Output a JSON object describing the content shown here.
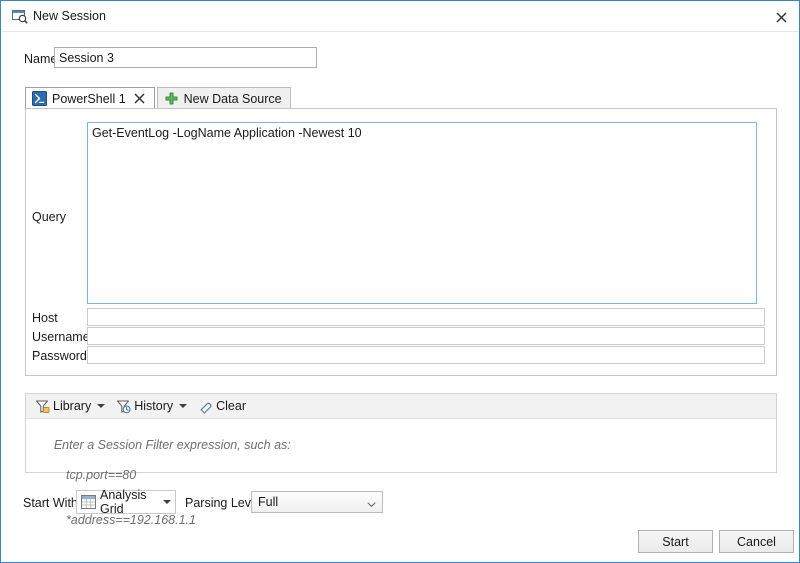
{
  "window": {
    "title": "New Session",
    "title_icon": "session-window-search-icon",
    "close_icon": "close-icon"
  },
  "name_row": {
    "label": "Name:",
    "value": "Session 3",
    "placeholder": ""
  },
  "tabs": [
    {
      "label": "PowerShell 1",
      "icon": "powershell-icon",
      "active": true,
      "close_icon": "tab-close-icon"
    },
    {
      "label": "New Data Source",
      "icon": "plus-icon",
      "active": false
    }
  ],
  "query_panel": {
    "query_label": "Query",
    "query_value": "Get-EventLog -LogName Application -Newest 10",
    "fields": [
      {
        "label": "Host",
        "value": "",
        "name": "host"
      },
      {
        "label": "Username",
        "value": "",
        "name": "username"
      },
      {
        "label": "Password",
        "value": "",
        "name": "password"
      }
    ]
  },
  "filter_panel": {
    "toolbar": [
      {
        "label": "Library",
        "icon": "filter-library-icon",
        "has_caret": true
      },
      {
        "label": "History",
        "icon": "filter-history-icon",
        "has_caret": true
      },
      {
        "label": "Clear",
        "icon": "eraser-icon",
        "has_caret": false
      }
    ],
    "hint_line1": "Enter a Session Filter expression, such as:",
    "hint_line2": "tcp.port==80",
    "hint_line3": "*address==192.168.1.1"
  },
  "bottom": {
    "start_with_label": "Start With:",
    "start_with_value": "Analysis Grid",
    "start_with_icon": "analysis-grid-icon",
    "parsing_level_label": "Parsing Level:",
    "parsing_level_value": "Full",
    "parsing_level_options": [
      "Full"
    ]
  },
  "footer": {
    "start_label": "Start",
    "cancel_label": "Cancel"
  },
  "colors": {
    "dialog_border": "#3a84c9",
    "focus_border": "#7eb4ea",
    "toolbar_bg": "#f2f2f2",
    "hint_text": "#6e6e6e",
    "powershell_blue": "#2b6cb0",
    "plus_green": "#4caf50"
  }
}
